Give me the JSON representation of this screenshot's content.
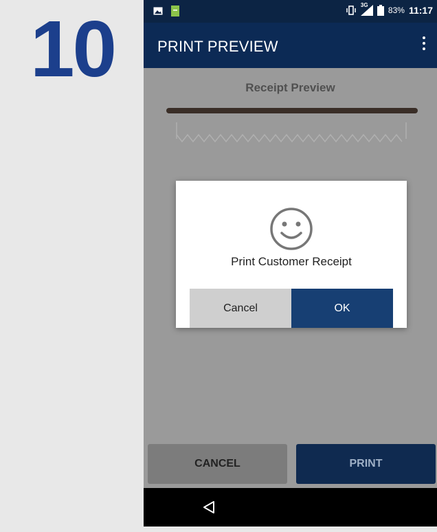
{
  "step_number": "10",
  "status_bar": {
    "icons": [
      "image-icon",
      "app-notification-icon",
      "vibrate-icon",
      "signal-icon",
      "battery-icon"
    ],
    "network": "3G",
    "battery": "83%",
    "time": "11:17"
  },
  "app_bar": {
    "title": "PRINT PREVIEW",
    "menu_icon": "more-vert-icon"
  },
  "receipt_preview": {
    "heading": "Receipt Preview"
  },
  "dialog": {
    "icon": "smiley-icon",
    "message": "Print Customer Receipt",
    "cancel_label": "Cancel",
    "ok_label": "OK"
  },
  "actions": {
    "cancel_label": "CANCEL",
    "print_label": "PRINT"
  },
  "nav_bar": {
    "back_icon": "back-triangle-icon"
  },
  "colors": {
    "step_number": "#1c3f8c",
    "app_bar": "#0c2a55",
    "ok_button": "#173f73",
    "print_button": "#0f2a50",
    "overlay": "#9a9a9a"
  }
}
